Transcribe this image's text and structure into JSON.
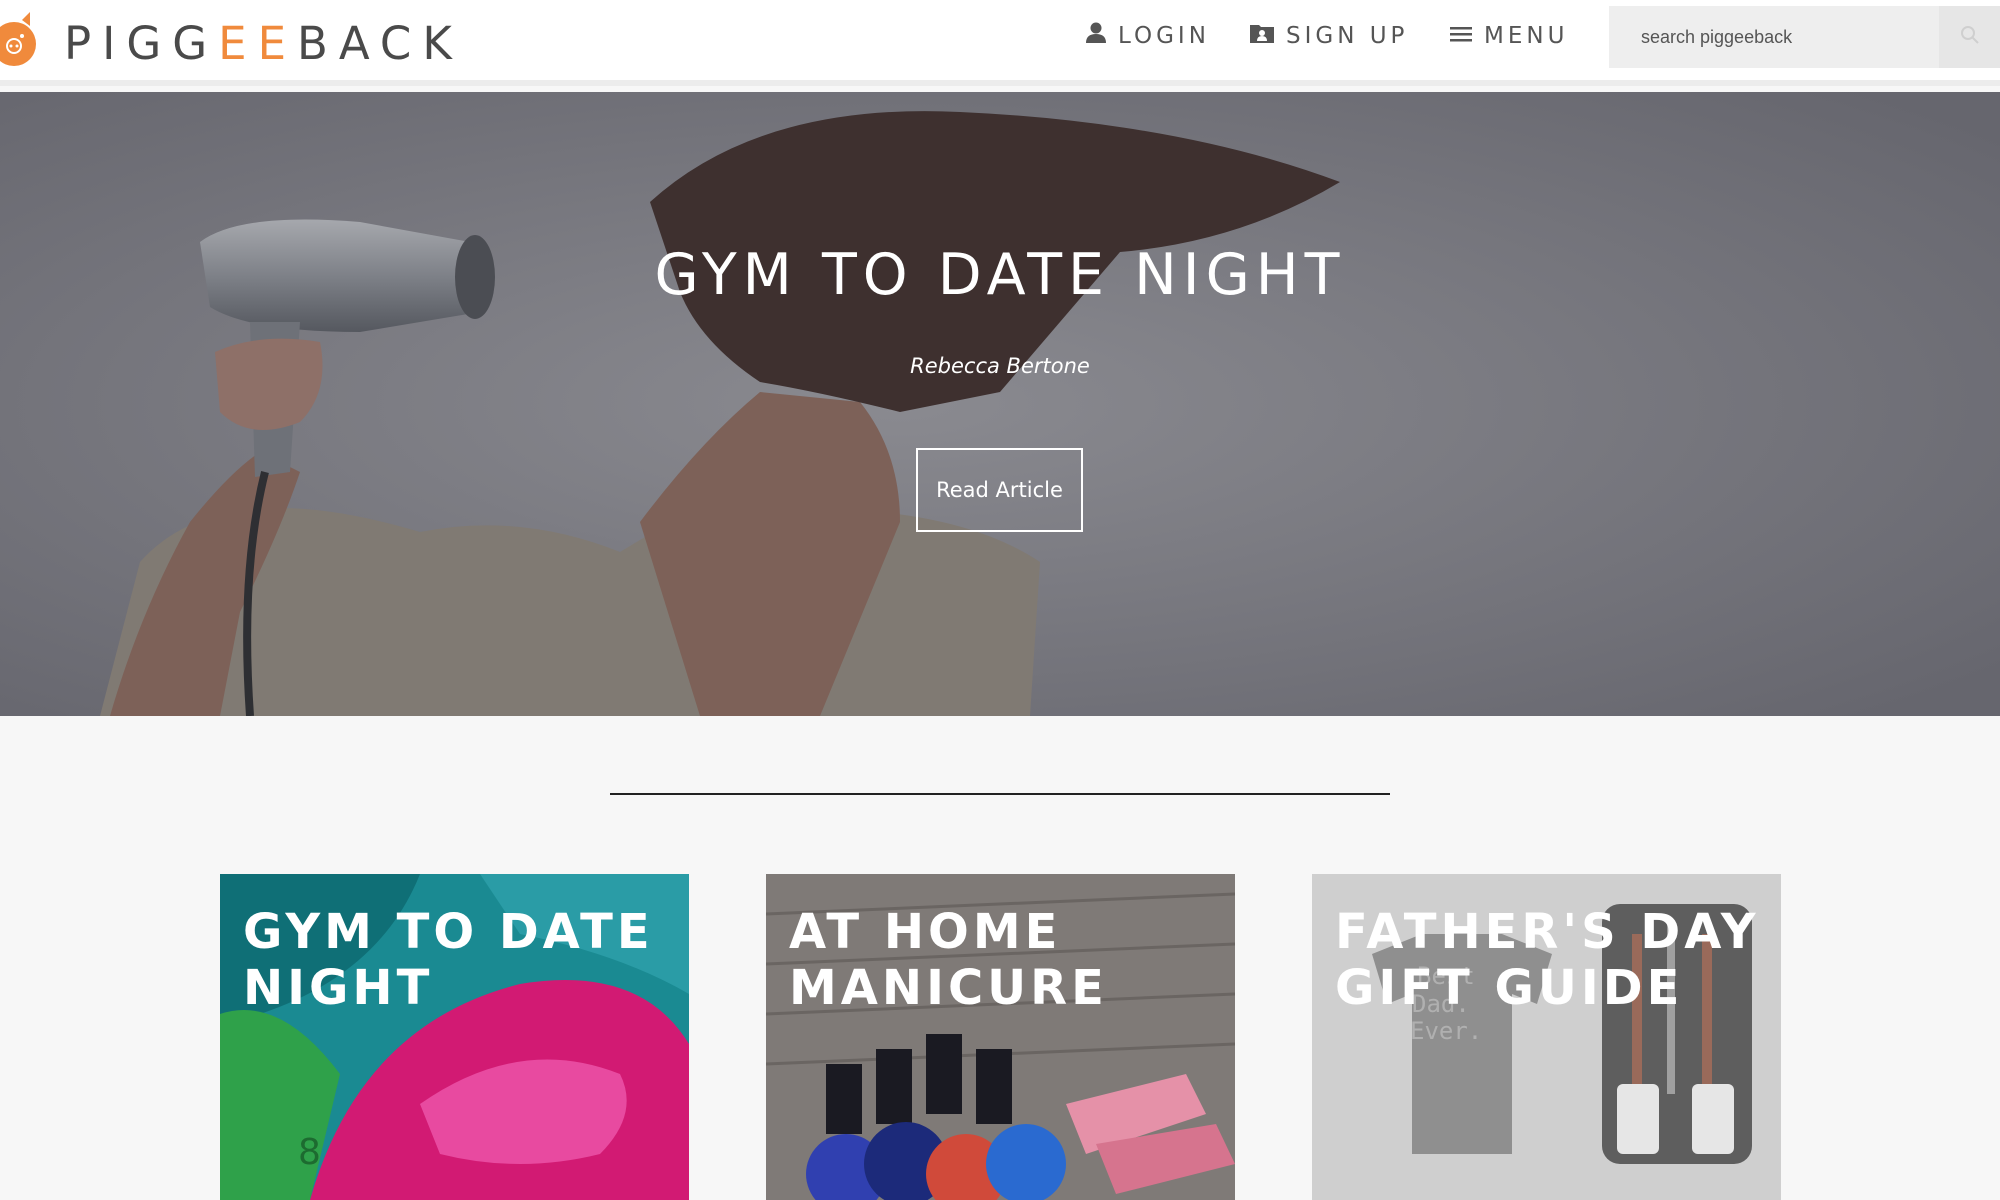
{
  "brand": {
    "name_part1": "PIGG",
    "name_part2": "EE",
    "name_part3": "BACK",
    "accent_color": "#f08a3c",
    "logo_icon": "pig-icon"
  },
  "nav": {
    "login_label": "LOGIN",
    "login_icon": "user-icon",
    "signup_label": "SIGN UP",
    "signup_icon": "folder-user-icon",
    "menu_label": "MENU",
    "menu_icon": "hamburger-icon"
  },
  "search": {
    "placeholder": "search piggeeback",
    "icon": "search-icon"
  },
  "hero": {
    "title": "GYM TO DATE NIGHT",
    "author": "Rebecca Bertone",
    "button_label": "Read Article"
  },
  "cards": [
    {
      "title": "GYM TO DATE NIGHT"
    },
    {
      "title": "AT HOME MANICURE"
    },
    {
      "title": "FATHER'S DAY GIFT GUIDE"
    }
  ]
}
